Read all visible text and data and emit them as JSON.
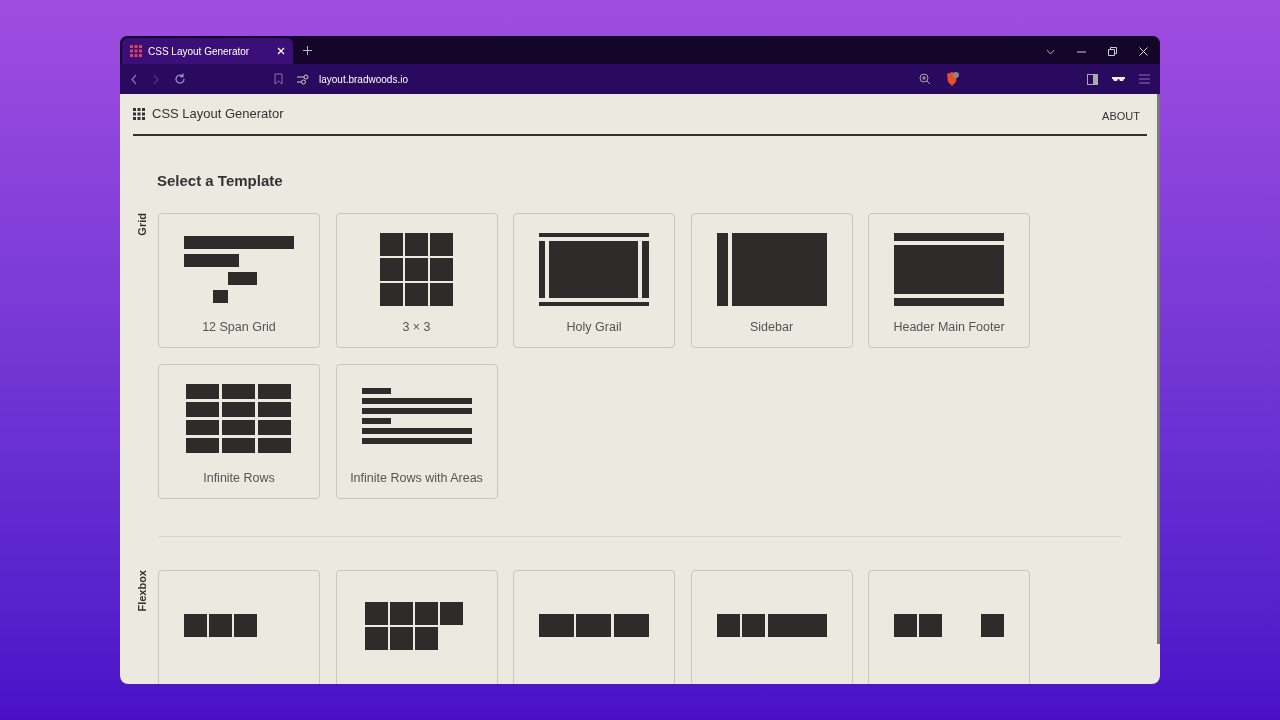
{
  "browser": {
    "tab_title": "CSS Layout Generator",
    "url": "layout.bradwoods.io"
  },
  "header": {
    "title": "CSS Layout Generator",
    "about_link": "ABOUT"
  },
  "heading": "Select a Template",
  "sections": [
    {
      "label": "Grid",
      "templates": [
        {
          "kind": "span12",
          "label": "12 Span Grid"
        },
        {
          "kind": "grid3",
          "label": "3 × 3"
        },
        {
          "kind": "holygrail",
          "label": "Holy Grail"
        },
        {
          "kind": "sidebar",
          "label": "Sidebar"
        },
        {
          "kind": "hmf",
          "label": "Header Main Footer"
        },
        {
          "kind": "infrows",
          "label": "Infinite Rows"
        },
        {
          "kind": "infareas",
          "label": "Infinite Rows with Areas"
        }
      ]
    },
    {
      "label": "Flexbox",
      "templates": [
        {
          "kind": "row"
        },
        {
          "kind": "rowwrap"
        },
        {
          "kind": "fill"
        },
        {
          "kind": "fillrem"
        },
        {
          "kind": "separate"
        }
      ]
    }
  ]
}
